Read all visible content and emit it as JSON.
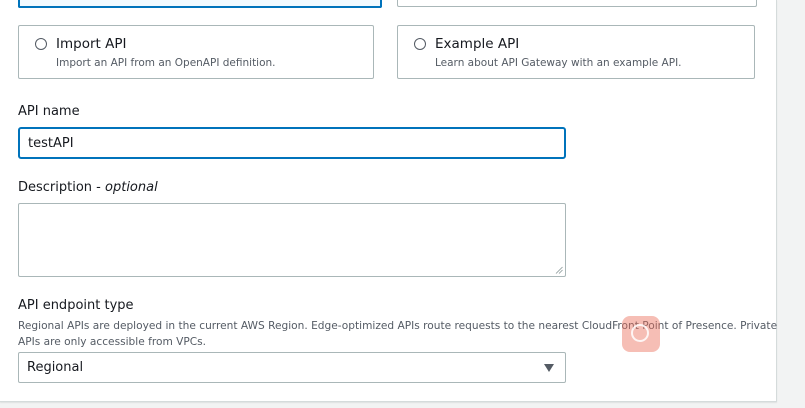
{
  "tiles": [
    {
      "title": "Import API",
      "description": "Import an API from an OpenAPI definition."
    },
    {
      "title": "Example API",
      "description": "Learn about API Gateway with an example API."
    }
  ],
  "api_name": {
    "label": "API name",
    "value": "testAPI"
  },
  "description": {
    "label": "Description",
    "optional_label": "optional",
    "value": ""
  },
  "endpoint_type": {
    "label": "API endpoint type",
    "help": "Regional APIs are deployed in the current AWS Region. Edge-optimized APIs route requests to the nearest CloudFront Point of Presence. Private APIs are only accessible from VPCs.",
    "selected": "Regional"
  },
  "colors": {
    "focus_border": "#0073bb",
    "input_border": "#aab7b8",
    "secondary_text": "#545b64"
  }
}
